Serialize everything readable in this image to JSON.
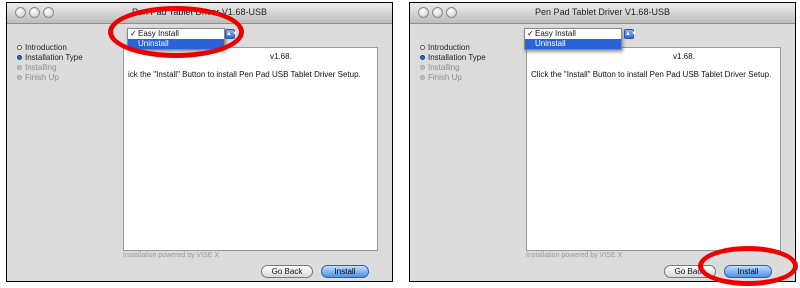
{
  "window_title": "Pen Pad Tablet Driver V1.68-USB",
  "steps": [
    {
      "label": "Introduction",
      "state": "done"
    },
    {
      "label": "Installation Type",
      "state": "current"
    },
    {
      "label": "Installing",
      "state": "pending"
    },
    {
      "label": "Finish Up",
      "state": "pending"
    }
  ],
  "left": {
    "version_fragment": "v1.68.",
    "body_text": "ick the \"Install\" Button to install Pen Pad USB Tablet Driver Setup."
  },
  "right": {
    "version_fragment": "v1.68.",
    "body_text": "Click the \"Install\" Button to install Pen Pad USB Tablet Driver Setup."
  },
  "dropdown": {
    "checkmark": "✓",
    "options": [
      "Easy Install",
      "Uninstall"
    ],
    "selected": "Easy Install",
    "highlighted": "Uninstall"
  },
  "footer": {
    "powered_by": "Installation powered by VISE X"
  },
  "buttons": {
    "back": "Go Back",
    "install": "Install"
  },
  "colors": {
    "highlight_circle": "#ee0000",
    "selection": "#2a63d6"
  }
}
